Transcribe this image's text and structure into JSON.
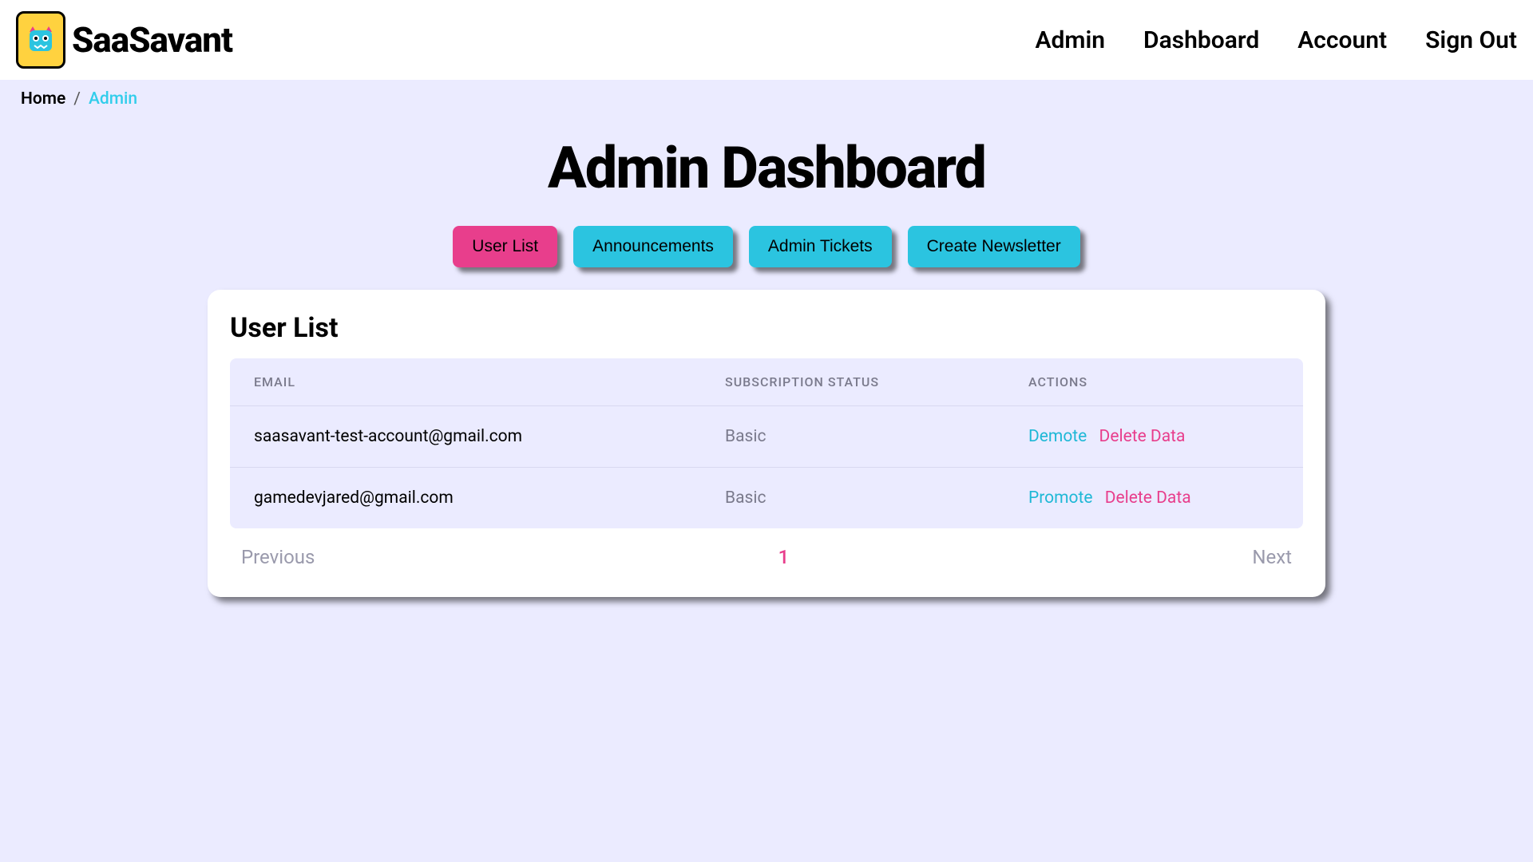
{
  "brand": "SaaSavant",
  "nav": {
    "admin": "Admin",
    "dashboard": "Dashboard",
    "account": "Account",
    "signout": "Sign Out"
  },
  "breadcrumb": {
    "home": "Home",
    "sep": "/",
    "current": "Admin"
  },
  "page_title": "Admin Dashboard",
  "tabs": {
    "user_list": "User List",
    "announcements": "Announcements",
    "admin_tickets": "Admin Tickets",
    "create_newsletter": "Create Newsletter"
  },
  "card": {
    "title": "User List",
    "columns": {
      "email": "EMAIL",
      "status": "SUBSCRIPTION STATUS",
      "actions": "ACTIONS"
    },
    "rows": [
      {
        "email": "saasavant-test-account@gmail.com",
        "status": "Basic",
        "action1": "Demote",
        "action2": "Delete Data"
      },
      {
        "email": "gamedevjared@gmail.com",
        "status": "Basic",
        "action1": "Promote",
        "action2": "Delete Data"
      }
    ],
    "pagination": {
      "prev": "Previous",
      "current": "1",
      "next": "Next"
    }
  }
}
